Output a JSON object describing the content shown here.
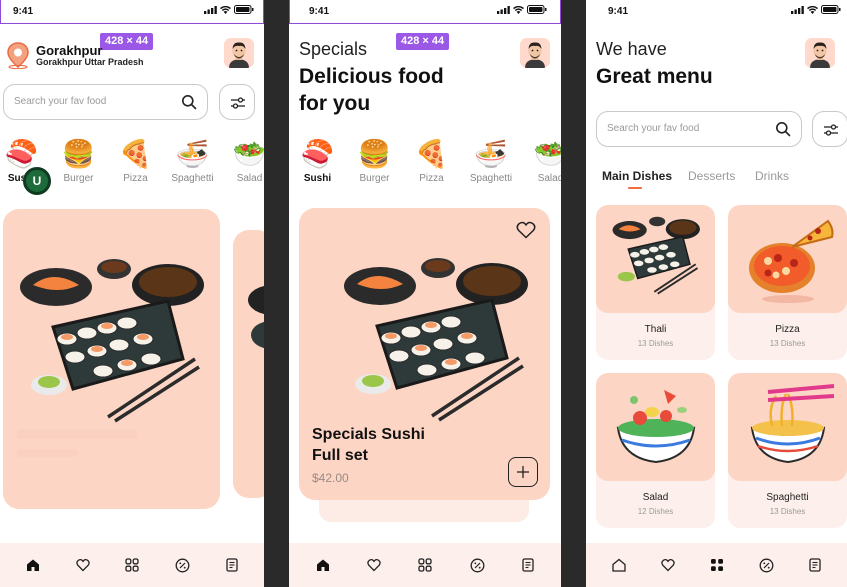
{
  "status": {
    "time": "9:41"
  },
  "dim_badge": "428 × 44",
  "phone1": {
    "location_title": "Gorakhpur",
    "location_sub": "Gorakhpur Uttar Pradesh",
    "search_placeholder": "Search your fav food",
    "cursor_letter": "U",
    "categories": [
      {
        "label": "Sushi",
        "icon": "sushi-icon",
        "active": true
      },
      {
        "label": "Burger",
        "icon": "burger-icon"
      },
      {
        "label": "Pizza",
        "icon": "pizza-icon"
      },
      {
        "label": "Spaghetti",
        "icon": "spaghetti-icon"
      },
      {
        "label": "Salad",
        "icon": "salad-icon"
      }
    ]
  },
  "phone2": {
    "subtitle": "Specials",
    "title_line1": "Delicious food",
    "title_line2": "for you",
    "categories": [
      {
        "label": "Sushi",
        "icon": "sushi-icon",
        "active": true
      },
      {
        "label": "Burger",
        "icon": "burger-icon"
      },
      {
        "label": "Pizza",
        "icon": "pizza-icon"
      },
      {
        "label": "Spaghetti",
        "icon": "spaghetti-icon"
      },
      {
        "label": "Salad",
        "icon": "salad-icon"
      }
    ],
    "special": {
      "name_line1": "Specials Sushi",
      "name_line2": "Full set",
      "price": "$42.00"
    }
  },
  "phone3": {
    "subtitle": "We have",
    "title": "Great menu",
    "search_placeholder": "Search your fav food",
    "tabs": [
      {
        "label": "Main Dishes",
        "active": true
      },
      {
        "label": "Desserts"
      },
      {
        "label": "Drinks"
      }
    ],
    "menu": [
      {
        "name": "Thali",
        "count": "13 Dishes",
        "icon": "thali-icon"
      },
      {
        "name": "Pizza",
        "count": "13 Dishes",
        "icon": "pizza-icon"
      },
      {
        "name": "Salad",
        "count": "12 Dishes",
        "icon": "salad-icon"
      },
      {
        "name": "Spaghetti",
        "count": "13 Dishes",
        "icon": "spaghetti-icon"
      }
    ]
  },
  "colors": {
    "accent": "#f26b3a",
    "card": "#fdd5c5",
    "nav_bg": "#fdf0ec",
    "selection": "#9b57e6"
  },
  "nav_icons": [
    "home-icon",
    "heart-icon",
    "grid-icon",
    "discount-icon",
    "receipt-icon"
  ]
}
